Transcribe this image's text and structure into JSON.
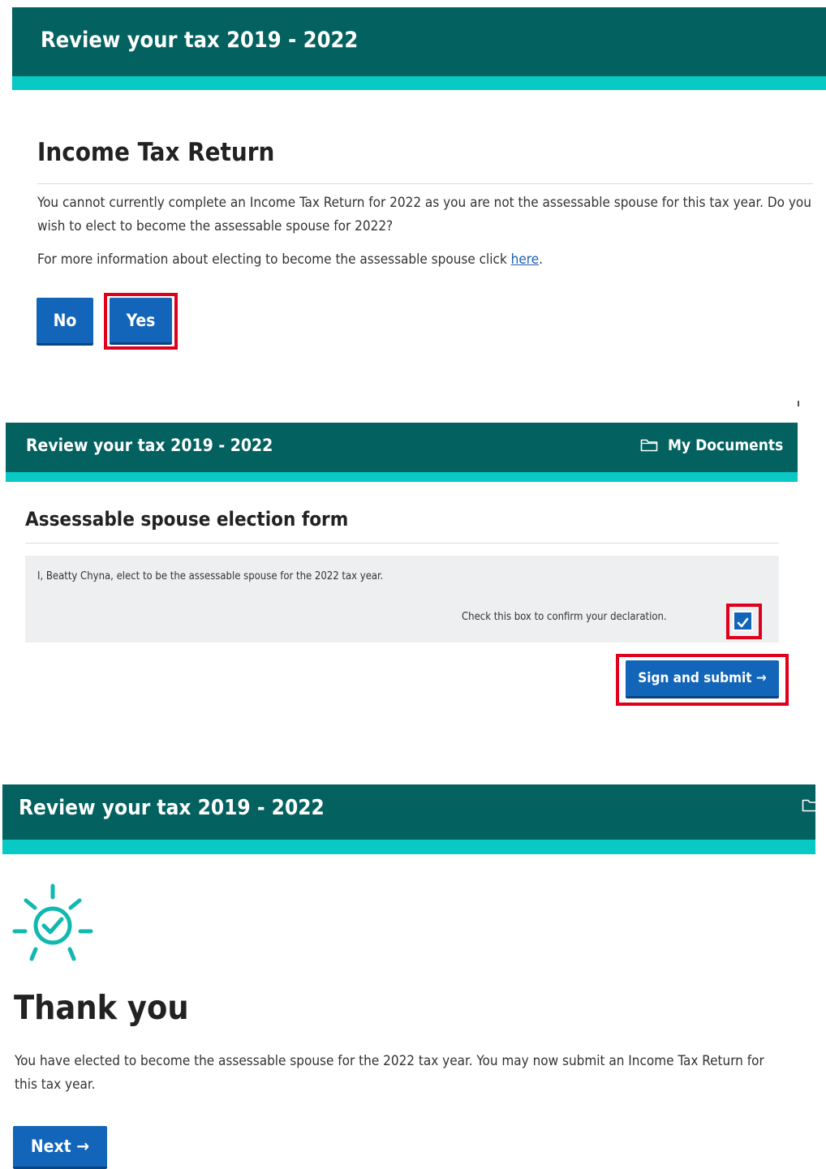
{
  "panel1": {
    "banner_title": "Review your tax 2019 - 2022",
    "heading": "Income Tax Return",
    "body": "You cannot currently complete an Income Tax Return for 2022 as you are not the assessable spouse for this tax year. Do you wish to elect to become the assessable spouse for 2022?",
    "info_prefix": "For more information about electing to become the assessable spouse click ",
    "info_link": "here",
    "info_suffix": ".",
    "no_label": "No",
    "yes_label": "Yes"
  },
  "panel2": {
    "banner_title": "Review your tax 2019 - 2022",
    "my_documents": "My Documents",
    "heading": "Assessable spouse election form",
    "declaration": "I, Beatty Chyna, elect to be the assessable spouse for the 2022 tax year.",
    "checkbox_label": "Check this box to confirm your declaration.",
    "checkbox_checked": true,
    "submit_label": "Sign and submit →"
  },
  "panel3": {
    "banner_title": "Review your tax 2019 - 2022",
    "heading": "Thank you",
    "body": "You have elected to become the assessable spouse for the 2022 tax year. You may now submit an Income Tax Return for this tax year.",
    "next_label": "Next →"
  },
  "icons": {
    "folder": "folder-icon",
    "success": "sun-checkmark-icon",
    "checkbox": "checkmark-icon"
  },
  "colors": {
    "banner_dark": "#03615f",
    "banner_accent": "#08c9c4",
    "button": "#1265b8",
    "highlight": "#e0001b",
    "success_icon": "#10b8b0"
  }
}
